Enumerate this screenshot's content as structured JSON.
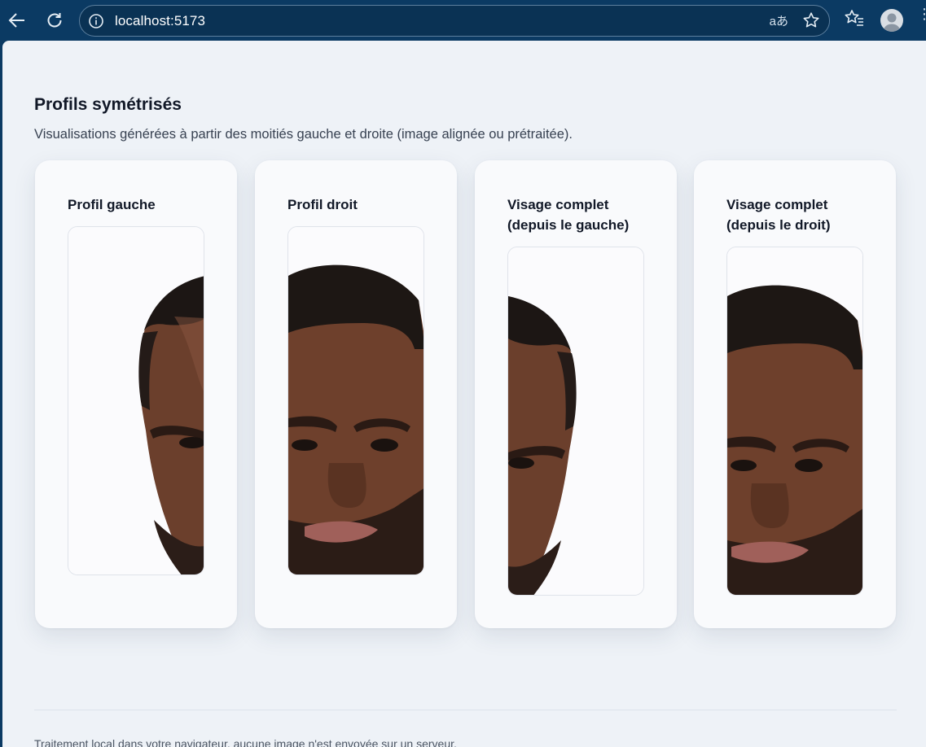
{
  "browser": {
    "url": "localhost:5173",
    "icons": {
      "back": "back-arrow-icon",
      "reload": "reload-icon",
      "info": "site-info-icon",
      "translate": "translate-icon",
      "star": "star-icon",
      "favorites": "favorites-icon",
      "profile": "profile-avatar-icon",
      "more": "more-icon"
    },
    "translate_glyph": "aあ"
  },
  "section": {
    "title": "Profils symétrisés",
    "subtitle": "Visualisations générées à partir des moitiés gauche et droite (image alignée ou prétraitée)."
  },
  "cards": [
    {
      "title": "Profil gauche"
    },
    {
      "title": "Profil droit"
    },
    {
      "title_line1": "Visage complet",
      "title_line2": "(depuis le gauche)"
    },
    {
      "title_line1": "Visage complet",
      "title_line2": "(depuis le droit)"
    }
  ],
  "footer": {
    "text": "Traitement local dans votre navigateur, aucune image n'est envoyée sur un serveur."
  },
  "colors": {
    "chrome": "#0b3a63",
    "page_bg": "#eef2f7",
    "card_bg": "#f9fafc",
    "text": "#111827"
  }
}
